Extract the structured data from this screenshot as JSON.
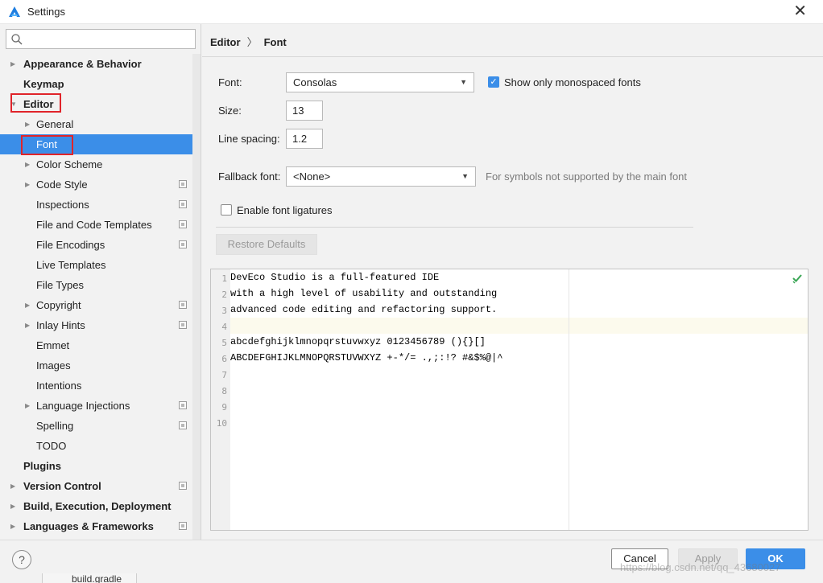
{
  "window": {
    "title": "Settings"
  },
  "search": {
    "placeholder": ""
  },
  "tree": {
    "appearance": "Appearance & Behavior",
    "keymap": "Keymap",
    "editor": "Editor",
    "general": "General",
    "font": "Font",
    "color_scheme": "Color Scheme",
    "code_style": "Code Style",
    "inspections": "Inspections",
    "file_code_templates": "File and Code Templates",
    "file_encodings": "File Encodings",
    "live_templates": "Live Templates",
    "file_types": "File Types",
    "copyright": "Copyright",
    "inlay_hints": "Inlay Hints",
    "emmet": "Emmet",
    "images": "Images",
    "intentions": "Intentions",
    "language_injections": "Language Injections",
    "spelling": "Spelling",
    "todo": "TODO",
    "plugins": "Plugins",
    "version_control": "Version Control",
    "build": "Build, Execution, Deployment",
    "languages": "Languages & Frameworks"
  },
  "breadcrumb": {
    "parent": "Editor",
    "separator": "〉",
    "current": "Font"
  },
  "form": {
    "font_label": "Font:",
    "font_value": "Consolas",
    "mono_label": "Show only monospaced fonts",
    "mono_checked": true,
    "size_label": "Size:",
    "size_value": "13",
    "spacing_label": "Line spacing:",
    "spacing_value": "1.2",
    "fallback_label": "Fallback font:",
    "fallback_value": "<None>",
    "fallback_hint": "For symbols not supported by the main font",
    "ligatures_label": "Enable font ligatures",
    "ligatures_checked": false,
    "restore_label": "Restore Defaults"
  },
  "preview": {
    "lines": [
      {
        "n": "1",
        "text": "DevEco Studio is a full-featured IDE"
      },
      {
        "n": "2",
        "text": "with a high level of usability and outstanding"
      },
      {
        "n": "3",
        "text": "advanced code editing and refactoring support."
      },
      {
        "n": "4",
        "text": ""
      },
      {
        "n": "5",
        "text": "abcdefghijklmnopqrstuvwxyz 0123456789 (){}[]"
      },
      {
        "n": "6",
        "text": "ABCDEFGHIJKLMNOPQRSTUVWXYZ +-*/= .,;:!? #&$%@|^"
      },
      {
        "n": "7",
        "text": ""
      },
      {
        "n": "8",
        "text": ""
      },
      {
        "n": "9",
        "text": ""
      },
      {
        "n": "10",
        "text": ""
      }
    ]
  },
  "footer": {
    "help": "?",
    "cancel": "Cancel",
    "apply": "Apply",
    "ok": "OK"
  },
  "background": {
    "tab": "build.gradle"
  },
  "watermark": "https://blog.csdn.net/qq_43680027",
  "colors": {
    "accent": "#3b8ee8",
    "highlight_box": "#e0242a"
  }
}
